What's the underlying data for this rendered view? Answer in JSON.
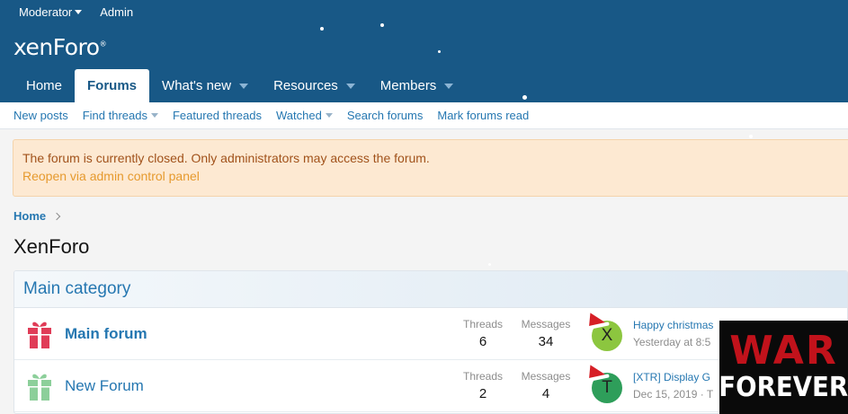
{
  "top_bar": {
    "items": [
      "Moderator",
      "Admin"
    ]
  },
  "logo": {
    "text": "xenForo",
    "mark": "®"
  },
  "nav": {
    "tabs": [
      {
        "label": "Home"
      },
      {
        "label": "Forums"
      },
      {
        "label": "What's new"
      },
      {
        "label": "Resources"
      },
      {
        "label": "Members"
      }
    ]
  },
  "subnav": {
    "links": [
      "New posts",
      "Find threads",
      "Featured threads",
      "Watched",
      "Search forums",
      "Mark forums read"
    ]
  },
  "notice": {
    "message": "The forum is currently closed. Only administrators may access the forum.",
    "link": "Reopen via admin control panel"
  },
  "breadcrumb": {
    "home": "Home"
  },
  "page_title": "XenForo",
  "category": {
    "title": "Main category",
    "forums": [
      {
        "title": "Main forum",
        "threads_label": "Threads",
        "threads": "6",
        "messages_label": "Messages",
        "messages": "34",
        "avatar_letter": "X",
        "avatar_color": "#8cc63f",
        "last_title": "Happy christmas",
        "last_meta": "Yesterday at 8:5"
      },
      {
        "title": "New Forum",
        "threads_label": "Threads",
        "threads": "2",
        "messages_label": "Messages",
        "messages": "4",
        "avatar_letter": "T",
        "avatar_color": "#2e9e5a",
        "last_title": "[XTR] Display G",
        "last_meta": "Dec 15, 2019 · T"
      }
    ]
  },
  "watermark": {
    "line1": "WAR",
    "line2": "FOREVER"
  },
  "colors": {
    "header": "#185886",
    "link": "#2577b1",
    "notice_bg": "#fde9d2",
    "gift_red": "#e03c57",
    "gift_green": "#8ccf9a"
  }
}
